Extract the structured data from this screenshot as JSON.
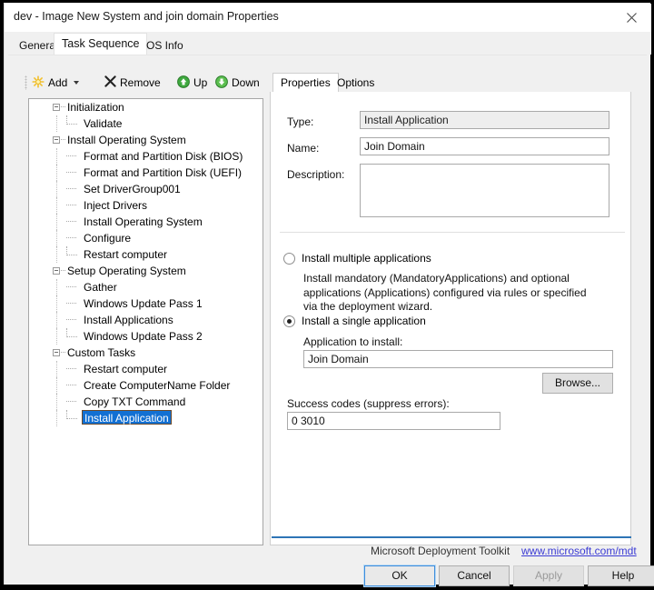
{
  "window": {
    "title": "dev - Image New System and join domain Properties",
    "close_icon": "close-icon"
  },
  "outer_tabs": [
    {
      "label": "General",
      "selected": false
    },
    {
      "label": "Task Sequence",
      "selected": true
    },
    {
      "label": "OS Info",
      "selected": false
    }
  ],
  "toolbar": {
    "add_label": "Add",
    "add_icon": "starburst-icon",
    "remove_label": "Remove",
    "remove_icon": "x-icon",
    "up_label": "Up",
    "up_icon": "arrow-up-circle-icon",
    "down_label": "Down",
    "down_icon": "arrow-down-circle-icon"
  },
  "tree": {
    "selected": "Install Application",
    "items": [
      {
        "label": "Initialization",
        "level": 1,
        "glyph": "expander",
        "selected": false
      },
      {
        "label": "Validate",
        "level": 2,
        "glyph": "last",
        "selected": false
      },
      {
        "label": "Install Operating System",
        "level": 1,
        "glyph": "expander",
        "selected": false
      },
      {
        "label": "Format and Partition Disk (BIOS)",
        "level": 2,
        "glyph": "mid",
        "selected": false
      },
      {
        "label": "Format and Partition Disk (UEFI)",
        "level": 2,
        "glyph": "mid",
        "selected": false
      },
      {
        "label": "Set DriverGroup001",
        "level": 2,
        "glyph": "mid",
        "selected": false
      },
      {
        "label": "Inject Drivers",
        "level": 2,
        "glyph": "mid",
        "selected": false
      },
      {
        "label": "Install Operating System",
        "level": 2,
        "glyph": "mid",
        "selected": false
      },
      {
        "label": "Configure",
        "level": 2,
        "glyph": "mid",
        "selected": false
      },
      {
        "label": "Restart computer",
        "level": 2,
        "glyph": "last",
        "selected": false
      },
      {
        "label": "Setup Operating System",
        "level": 1,
        "glyph": "expander",
        "selected": false
      },
      {
        "label": "Gather",
        "level": 2,
        "glyph": "mid",
        "selected": false
      },
      {
        "label": "Windows Update Pass 1",
        "level": 2,
        "glyph": "mid",
        "selected": false
      },
      {
        "label": "Install Applications",
        "level": 2,
        "glyph": "mid",
        "selected": false
      },
      {
        "label": "Windows Update Pass 2",
        "level": 2,
        "glyph": "last",
        "selected": false
      },
      {
        "label": "Custom Tasks",
        "level": 1,
        "glyph": "expander",
        "selected": false
      },
      {
        "label": "Restart computer",
        "level": 2,
        "glyph": "mid",
        "selected": false
      },
      {
        "label": "Create ComputerName Folder",
        "level": 2,
        "glyph": "mid",
        "selected": false
      },
      {
        "label": "Copy TXT Command",
        "level": 2,
        "glyph": "mid",
        "selected": false
      },
      {
        "label": "Install Application",
        "level": 2,
        "glyph": "last",
        "selected": true
      }
    ]
  },
  "inner_tabs": [
    {
      "label": "Properties",
      "selected": true
    },
    {
      "label": "Options",
      "selected": false
    }
  ],
  "properties": {
    "type_label": "Type:",
    "type_value": "Install Application",
    "name_label": "Name:",
    "name_value": "Join Domain",
    "description_label": "Description:",
    "description_value": "",
    "radio_multiple_label": "Install multiple applications",
    "radio_multiple_checked": false,
    "multiple_description": "Install mandatory (MandatoryApplications) and optional applications (Applications) configured via rules or specified via the deployment wizard.",
    "radio_single_label": "Install a single application",
    "radio_single_checked": true,
    "application_to_install_label": "Application to install:",
    "application_to_install_value": "Join Domain",
    "browse_label": "Browse...",
    "success_codes_label": "Success codes (suppress errors):",
    "success_codes_value": "0 3010"
  },
  "footer": {
    "brand": "Microsoft Deployment Toolkit",
    "link": "www.microsoft.com/mdt",
    "accent_color": "#2e75b6",
    "link_color": "#3b3bd4"
  },
  "dialog_buttons": {
    "ok": "OK",
    "cancel": "Cancel",
    "apply": "Apply",
    "help": "Help"
  },
  "colors": {
    "selection_blue": "#1270d3",
    "window_bg": "#f0f0f0",
    "panel_bg": "#ffffff"
  }
}
